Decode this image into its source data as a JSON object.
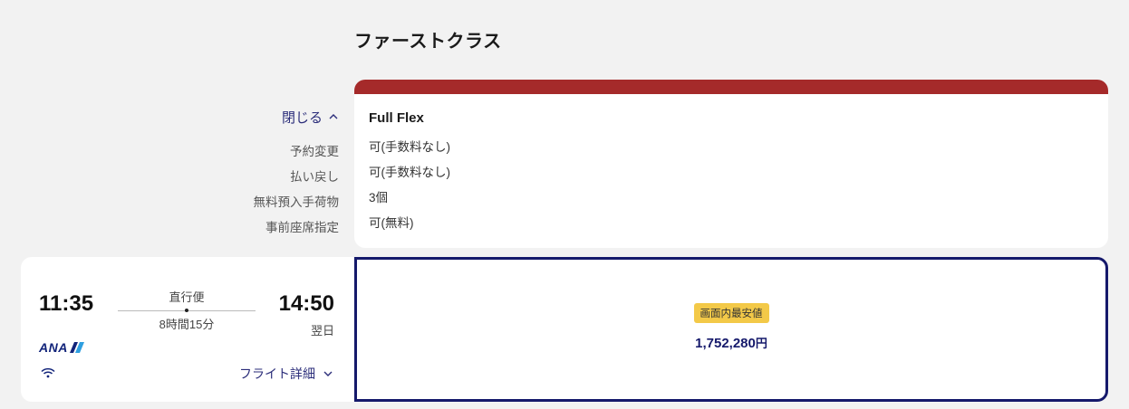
{
  "cabin_class": "ファーストクラス",
  "toggle": {
    "label": "閉じる"
  },
  "fare": {
    "name": "Full Flex",
    "header_color": "#a52a2a",
    "rows": [
      {
        "label": "予約変更",
        "value": "可(手数料なし)"
      },
      {
        "label": "払い戻し",
        "value": "可(手数料なし)"
      },
      {
        "label": "無料預入手荷物",
        "value": "3個"
      },
      {
        "label": "事前座席指定",
        "value": "可(無料)"
      }
    ]
  },
  "flight": {
    "departure_time": "11:35",
    "arrival_time": "14:50",
    "arrival_note": "翌日",
    "route_type": "直行便",
    "duration": "8時間15分",
    "airline": "ANA",
    "detail_label": "フライト詳細"
  },
  "price_card": {
    "badge": "画面内最安値",
    "amount": "1,752,280",
    "currency": "円"
  },
  "colors": {
    "accent": "#15196b",
    "badge": "#f3c948",
    "link": "#2b2d7a"
  }
}
